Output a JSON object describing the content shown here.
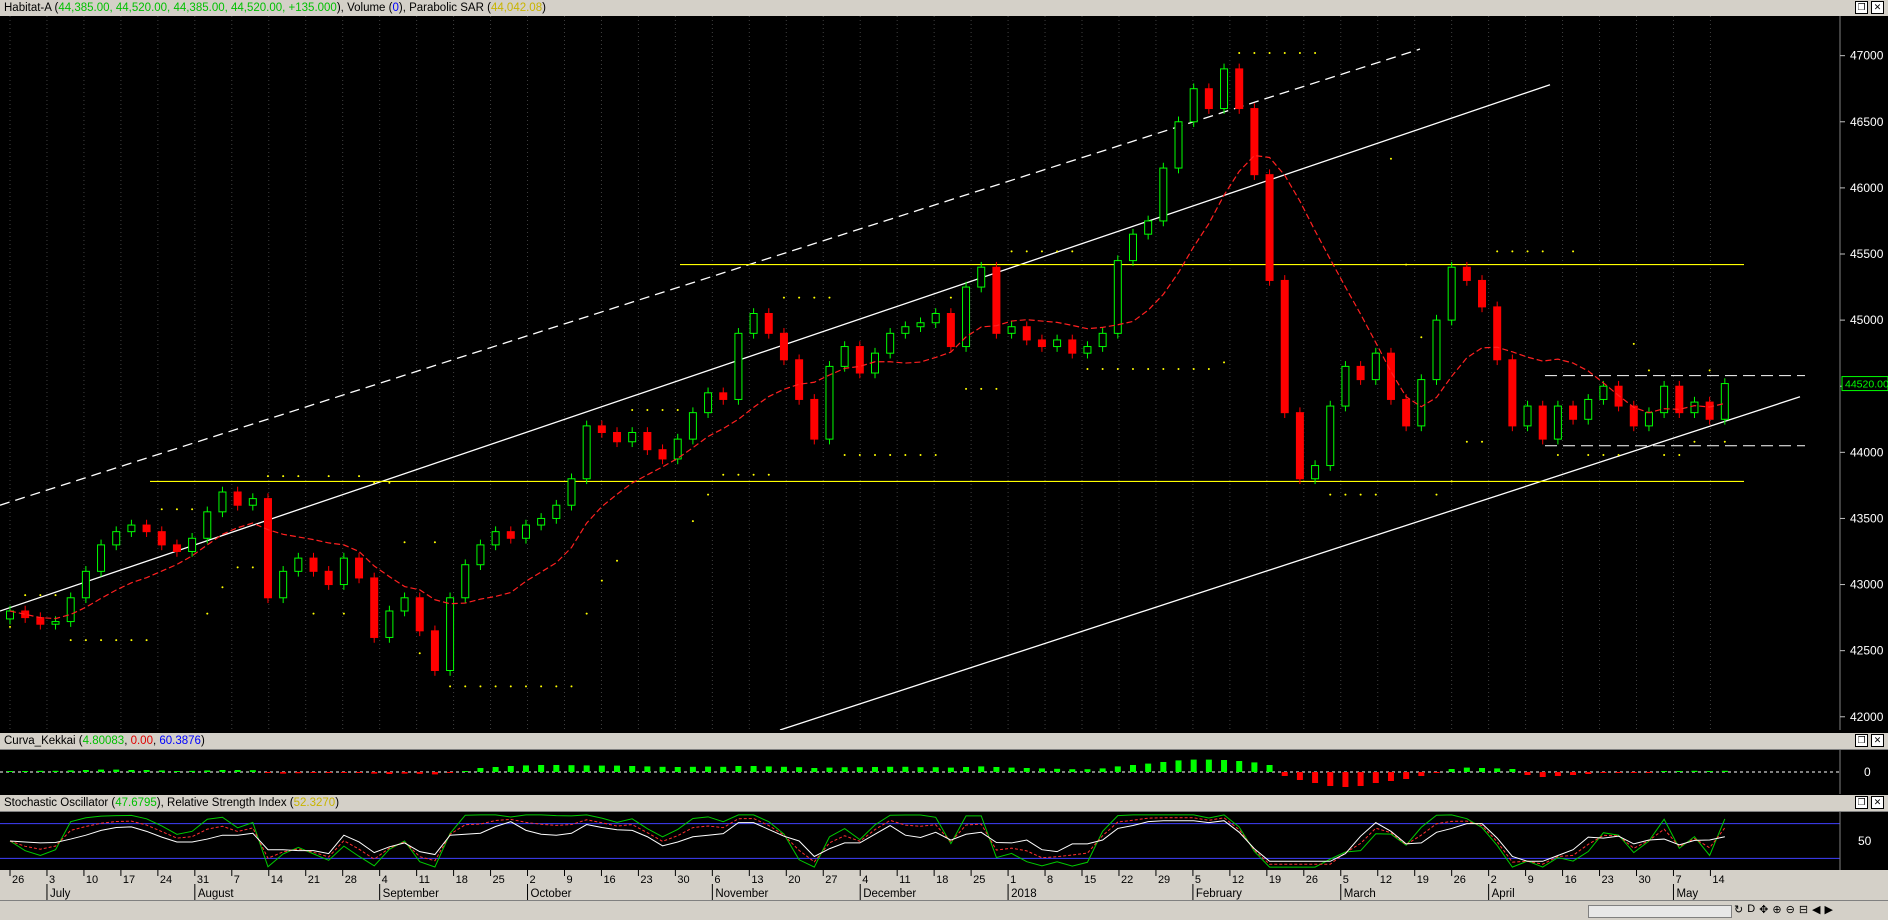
{
  "panes": {
    "price": {
      "symbol": "Habitat-A",
      "ohlc": "44,385.00, 44,520.00, 44,385.00, 44,520.00, +135.000",
      "volume_label": "Volume",
      "volume_value": "0",
      "sar_label": "Parabolic SAR",
      "sar_value": "44,042.08",
      "last_price_tag": "44520.00"
    },
    "kekkai": {
      "label": "Curva_Kekkai",
      "v1": "4.80083",
      "v2": "0.00",
      "v3": "60.3876"
    },
    "stoch": {
      "label": "Stochastic Oscillator",
      "v1": "47.6795",
      "rsi_label": "Relative Strength Index",
      "v2": "52.3270"
    }
  },
  "colors": {
    "bull": "#00ff00",
    "bear": "#ff0000",
    "ma": "#ff2020",
    "sar": "#ffff00",
    "support": "#ffff00",
    "channel": "#ffffff",
    "bg": "#000000",
    "grid": "#404040"
  },
  "chart_data": [
    {
      "type": "candlestick",
      "ylim": [
        41900,
        47300
      ],
      "y_ticks": [
        42000,
        42500,
        43000,
        43500,
        44000,
        44500,
        45000,
        45500,
        46000,
        46500,
        47000
      ],
      "close": [
        42800,
        42750,
        42700,
        42720,
        42900,
        43100,
        43300,
        43400,
        43450,
        43400,
        43300,
        43250,
        43350,
        43550,
        43700,
        43600,
        43650,
        42900,
        43100,
        43200,
        43100,
        43000,
        43200,
        43050,
        42600,
        42800,
        42900,
        42650,
        42350,
        42900,
        43150,
        43300,
        43400,
        43350,
        43450,
        43500,
        43600,
        43800,
        44200,
        44150,
        44080,
        44150,
        44020,
        43950,
        44100,
        44300,
        44450,
        44400,
        44900,
        45050,
        44900,
        44700,
        44400,
        44100,
        44650,
        44800,
        44600,
        44750,
        44900,
        44950,
        44980,
        45050,
        44800,
        45250,
        45400,
        44900,
        44950,
        44850,
        44800,
        44850,
        44750,
        44800,
        44900,
        45450,
        45650,
        45750,
        46150,
        46500,
        46750,
        46600,
        46900,
        46600,
        46100,
        45300,
        44300,
        43800,
        43900,
        44350,
        44650,
        44550,
        44750,
        44400,
        44200,
        44550,
        45000,
        45400,
        45300,
        45100,
        44700,
        44200,
        44350,
        44100,
        44350,
        44250,
        44400,
        44500,
        44350,
        44200,
        44300,
        44500,
        44300,
        44380,
        44250,
        44520
      ],
      "ma_series": "Moving Average (red dashed)",
      "sar_series": "Parabolic SAR (yellow dots)",
      "last": 44520,
      "support_levels": [
        45420,
        43780
      ],
      "range_box": [
        44580,
        44050
      ]
    },
    {
      "type": "bar",
      "ylim": [
        -1,
        1
      ],
      "y_ticks": [
        0
      ],
      "values": [
        0.05,
        0.05,
        0.06,
        0.06,
        0.08,
        0.1,
        0.12,
        0.12,
        0.1,
        0.1,
        0.08,
        0.05,
        0.06,
        0.08,
        0.1,
        0.1,
        0.09,
        -0.05,
        -0.08,
        -0.06,
        -0.05,
        -0.04,
        -0.03,
        -0.04,
        -0.08,
        -0.1,
        -0.08,
        -0.09,
        -0.12,
        -0.05,
        0.05,
        0.2,
        0.25,
        0.3,
        0.33,
        0.35,
        0.35,
        0.34,
        0.33,
        0.32,
        0.32,
        0.3,
        0.28,
        0.26,
        0.25,
        0.26,
        0.27,
        0.26,
        0.3,
        0.3,
        0.28,
        0.26,
        0.24,
        0.2,
        0.22,
        0.24,
        0.24,
        0.25,
        0.26,
        0.26,
        0.24,
        0.24,
        0.22,
        0.25,
        0.28,
        0.25,
        0.22,
        0.2,
        0.18,
        0.16,
        0.14,
        0.14,
        0.18,
        0.28,
        0.35,
        0.42,
        0.5,
        0.58,
        0.62,
        0.62,
        0.6,
        0.55,
        0.48,
        0.35,
        -0.2,
        -0.4,
        -0.55,
        -0.7,
        -0.75,
        -0.7,
        -0.55,
        -0.45,
        -0.35,
        -0.2,
        -0.05,
        0.15,
        0.22,
        0.2,
        0.18,
        0.15,
        -0.15,
        -0.25,
        -0.2,
        -0.15,
        -0.1,
        -0.05,
        -0.05,
        -0.05,
        -0.02,
        0.05,
        0.05,
        0.06,
        0.05,
        0.06
      ]
    },
    {
      "type": "line",
      "ylim": [
        0,
        100
      ],
      "y_ticks": [
        50
      ],
      "levels": [
        80,
        20
      ]
    }
  ],
  "x_axis": {
    "day_ticks": [
      "26",
      "3",
      "10",
      "17",
      "24",
      "31",
      "7",
      "14",
      "21",
      "28",
      "4",
      "11",
      "18",
      "25",
      "2",
      "9",
      "16",
      "23",
      "30",
      "6",
      "13",
      "20",
      "27",
      "4",
      "11",
      "18",
      "25",
      "1",
      "8",
      "15",
      "22",
      "29",
      "5",
      "12",
      "19",
      "26",
      "5",
      "12",
      "19",
      "26",
      "2",
      "9",
      "16",
      "23",
      "30",
      "7",
      "14"
    ],
    "month_labels": [
      "July",
      "August",
      "September",
      "October",
      "November",
      "December",
      "2018",
      "February",
      "March",
      "April",
      "May"
    ]
  }
}
